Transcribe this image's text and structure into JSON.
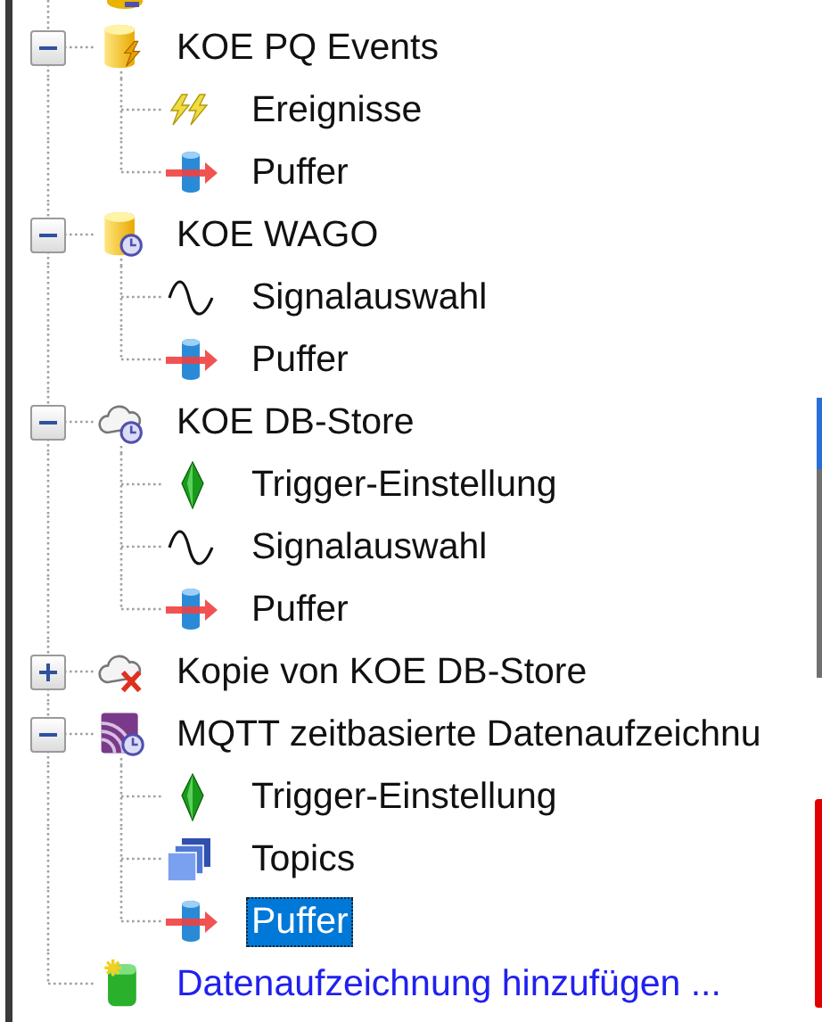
{
  "tree": {
    "items": [
      {
        "label": "KOE PQ Events",
        "kind": "events-store",
        "expanded": true,
        "selected": false,
        "children": [
          {
            "label": "Ereignisse",
            "kind": "events",
            "selected": false
          },
          {
            "label": "Puffer",
            "kind": "buffer",
            "selected": false
          }
        ]
      },
      {
        "label": "KOE WAGO",
        "kind": "timed-store",
        "expanded": true,
        "selected": false,
        "children": [
          {
            "label": "Signalauswahl",
            "kind": "signal",
            "selected": false
          },
          {
            "label": "Puffer",
            "kind": "buffer",
            "selected": false
          }
        ]
      },
      {
        "label": "KOE DB-Store",
        "kind": "cloud-store",
        "expanded": true,
        "selected": false,
        "children": [
          {
            "label": "Trigger-Einstellung",
            "kind": "trigger",
            "selected": false
          },
          {
            "label": "Signalauswahl",
            "kind": "signal",
            "selected": false
          },
          {
            "label": "Puffer",
            "kind": "buffer",
            "selected": false
          }
        ]
      },
      {
        "label": "Kopie von KOE DB-Store",
        "kind": "cloud-error",
        "expanded": false,
        "selected": false
      },
      {
        "label": "MQTT zeitbasierte Datenaufzeichnu",
        "kind": "mqtt",
        "expanded": true,
        "selected": false,
        "children": [
          {
            "label": "Trigger-Einstellung",
            "kind": "trigger",
            "selected": false
          },
          {
            "label": "Topics",
            "kind": "topics",
            "selected": false
          },
          {
            "label": "Puffer",
            "kind": "buffer",
            "selected": true
          }
        ]
      }
    ],
    "add_link": {
      "label": "Datenaufzeichnung hinzufügen ..."
    }
  }
}
